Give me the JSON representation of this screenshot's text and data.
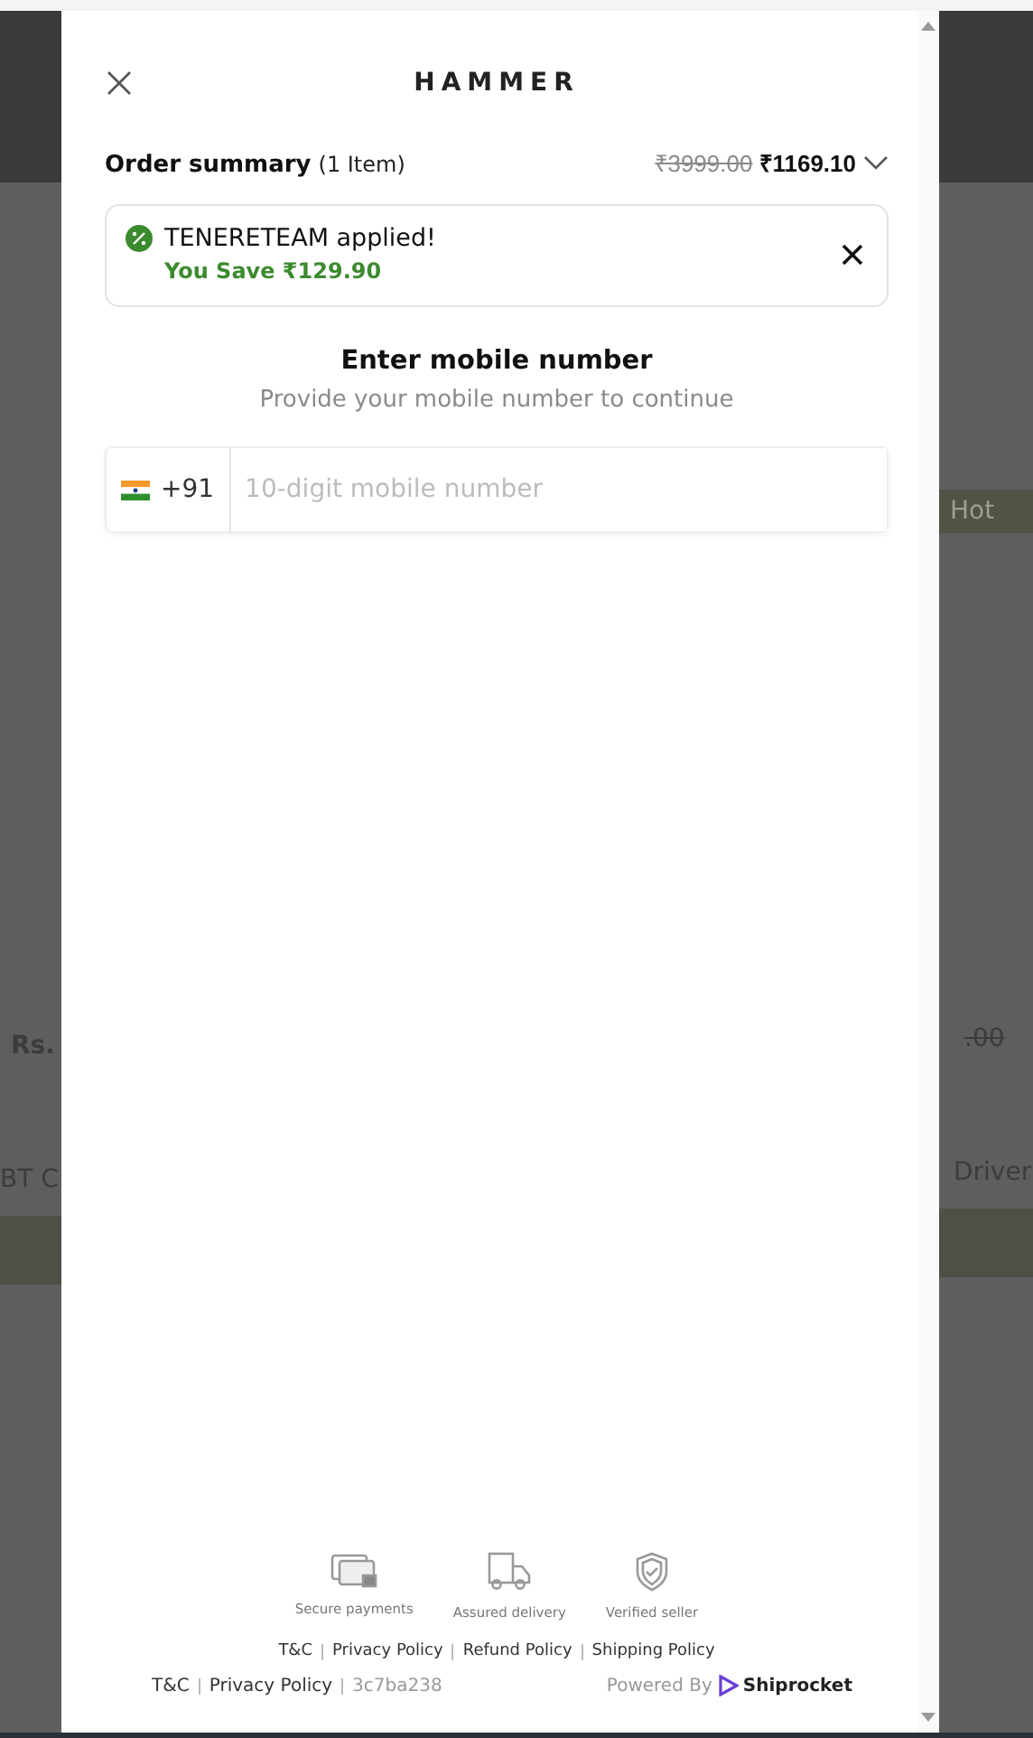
{
  "background": {
    "left_texts": [
      "Rs.",
      "BT C"
    ],
    "right_badge": "Hot",
    "right_price": ".00",
    "right_name": "Driver"
  },
  "modal": {
    "logo": "HAMMER",
    "order_summary": {
      "title": "Order summary",
      "count": "(1 Item)",
      "original_price": "₹3999.00",
      "price": "₹1169.10",
      "expanded": false
    },
    "coupon": {
      "title": "TENERETEAM applied!",
      "savings": "You Save ₹129.90"
    },
    "heading": "Enter mobile number",
    "subheading": "Provide your mobile number to continue",
    "phone": {
      "country_code": "+91",
      "placeholder": "10-digit mobile number"
    },
    "badges": [
      {
        "kind": "card",
        "label": "Secure payments"
      },
      {
        "kind": "truck",
        "label": "Assured delivery"
      },
      {
        "kind": "shield",
        "label": "Verified seller"
      }
    ],
    "links": [
      "T&C",
      "Privacy Policy",
      "Refund Policy",
      "Shipping Policy"
    ],
    "bottom_links": [
      "T&C",
      "Privacy Policy"
    ],
    "build": "3c7ba238",
    "powered_by": "Powered By",
    "brand": "Shiprocket"
  }
}
